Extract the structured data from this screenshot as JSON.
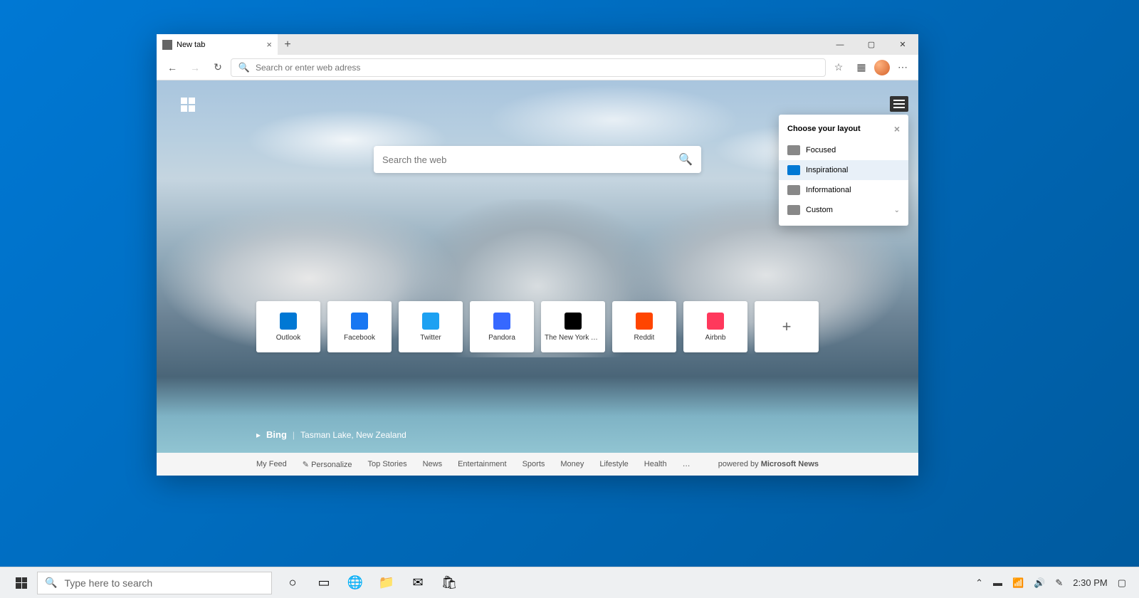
{
  "browser": {
    "tab_title": "New tab",
    "address_placeholder": "Search or enter web adress",
    "window_controls": {
      "minimize": "—",
      "maximize": "▢",
      "close": "✕"
    }
  },
  "ntp": {
    "search_placeholder": "Search the web",
    "tiles": [
      {
        "label": "Outlook",
        "color": "#0078d4"
      },
      {
        "label": "Facebook",
        "color": "#1877f2"
      },
      {
        "label": "Twitter",
        "color": "#1da1f2"
      },
      {
        "label": "Pandora",
        "color": "#3668ff"
      },
      {
        "label": "The New York Ti...",
        "color": "#000000"
      },
      {
        "label": "Reddit",
        "color": "#ff4500"
      },
      {
        "label": "Airbnb",
        "color": "#ff385c"
      }
    ],
    "attribution": {
      "brand": "Bing",
      "location": "Tasman Lake, New Zealand"
    },
    "news_links": [
      "My Feed",
      "Personalize",
      "Top Stories",
      "News",
      "Entertainment",
      "Sports",
      "Money",
      "Lifestyle",
      "Health",
      "…"
    ],
    "news_powered": "powered by",
    "news_brand": "Microsoft News"
  },
  "layout_popup": {
    "title": "Choose your layout",
    "options": [
      {
        "label": "Focused",
        "selected": false
      },
      {
        "label": "Inspirational",
        "selected": true
      },
      {
        "label": "Informational",
        "selected": false
      },
      {
        "label": "Custom",
        "selected": false,
        "expandable": true
      }
    ]
  },
  "taskbar": {
    "search_placeholder": "Type here to search",
    "time": "2:30 PM"
  }
}
